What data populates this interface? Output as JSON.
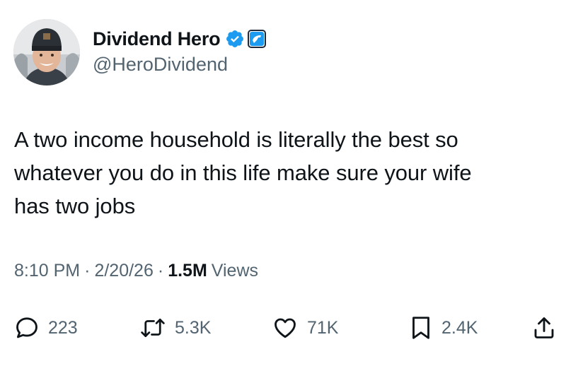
{
  "author": {
    "display_name": "Dividend Hero",
    "handle": "@HeroDividend",
    "verified_icon": "verified-badge-icon",
    "affiliate_icon": "affiliate-badge-icon"
  },
  "tweet": {
    "text": "A two income household is literally the best so\nwhatever you do in this life make sure your wife\nhas two jobs"
  },
  "meta": {
    "time": "8:10 PM",
    "separator": "·",
    "date": "2/20/26",
    "views_count": "1.5M",
    "views_label": "Views"
  },
  "actions": {
    "replies": "223",
    "retweets": "5.3K",
    "likes": "71K",
    "bookmarks": "2.4K"
  },
  "colors": {
    "text": "#0f1419",
    "secondary": "#536471",
    "verified_blue": "#1d9bf0"
  }
}
